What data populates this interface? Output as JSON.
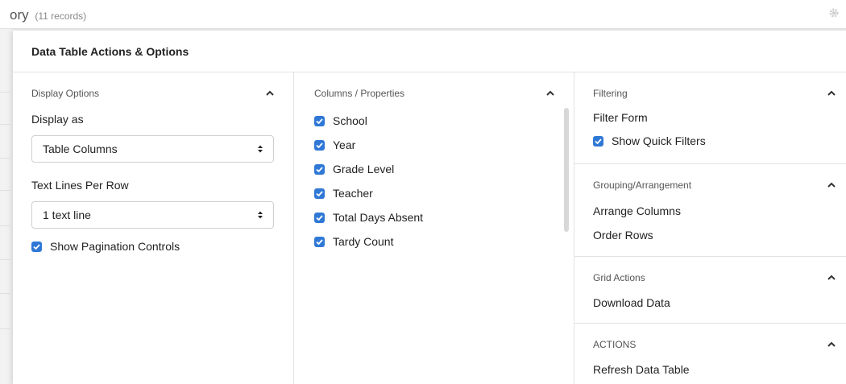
{
  "page": {
    "title": "ory",
    "record_count": "(11 records)"
  },
  "panel": {
    "title": "Data Table Actions & Options"
  },
  "display_options": {
    "title": "Display Options",
    "display_as_label": "Display as",
    "display_as_value": "Table Columns",
    "text_lines_label": "Text Lines Per Row",
    "text_lines_value": "1 text line",
    "show_pagination_label": "Show Pagination Controls"
  },
  "columns": {
    "title": "Columns / Properties",
    "items": [
      {
        "label": "School"
      },
      {
        "label": "Year"
      },
      {
        "label": "Grade Level"
      },
      {
        "label": "Teacher"
      },
      {
        "label": "Total Days Absent"
      },
      {
        "label": "Tardy Count"
      }
    ]
  },
  "filtering": {
    "title": "Filtering",
    "filter_form": "Filter Form",
    "show_quick_filters": "Show Quick Filters"
  },
  "grouping": {
    "title": "Grouping/Arrangement",
    "arrange_columns": "Arrange Columns",
    "order_rows": "Order Rows"
  },
  "grid_actions": {
    "title": "Grid Actions",
    "download_data": "Download Data"
  },
  "actions": {
    "title": "ACTIONS",
    "refresh": "Refresh Data Table"
  },
  "colors": {
    "checkbox": "#2f78d6",
    "border": "#e2e2e2"
  },
  "icons": [
    "gear-icon",
    "chevron-up-icon",
    "select-arrows-icon",
    "checkmark-icon"
  ]
}
